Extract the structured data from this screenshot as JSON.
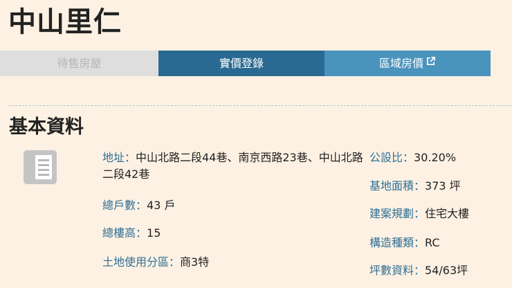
{
  "page": {
    "title": "中山里仁"
  },
  "tabs": [
    {
      "label": "待售房屋",
      "state": "disabled"
    },
    {
      "label": "實價登錄",
      "state": "active"
    },
    {
      "label": "區域房價",
      "state": "external-link"
    }
  ],
  "section": {
    "title": "基本資料",
    "icon": "document-icon"
  },
  "info_left": {
    "address_label": "地址：",
    "address_value": "中山北路二段44巷、南京西路23巷、中山北路二段42巷",
    "households_label": "總戶數：",
    "households_value": "43 戶",
    "floors_label": "總樓高：",
    "floors_value": "15",
    "zoning_label": "土地使用分區：",
    "zoning_value": "商3特"
  },
  "info_right": {
    "public_ratio_label": "公設比：",
    "public_ratio_value": "30.20%",
    "land_area_label": "基地面積：",
    "land_area_value": "373 坪",
    "planning_label": "建案規劃：",
    "planning_value": "住宅大樓",
    "structure_label": "構造種類：",
    "structure_value": "RC",
    "ping_label": "坪數資料：",
    "ping_value": "54/63坪"
  },
  "colors": {
    "background": "#fcf1e3",
    "tab_active": "#2a6a92",
    "tab_link": "#4a93bd",
    "tab_disabled": "#dedede",
    "label": "#2f6f94"
  }
}
